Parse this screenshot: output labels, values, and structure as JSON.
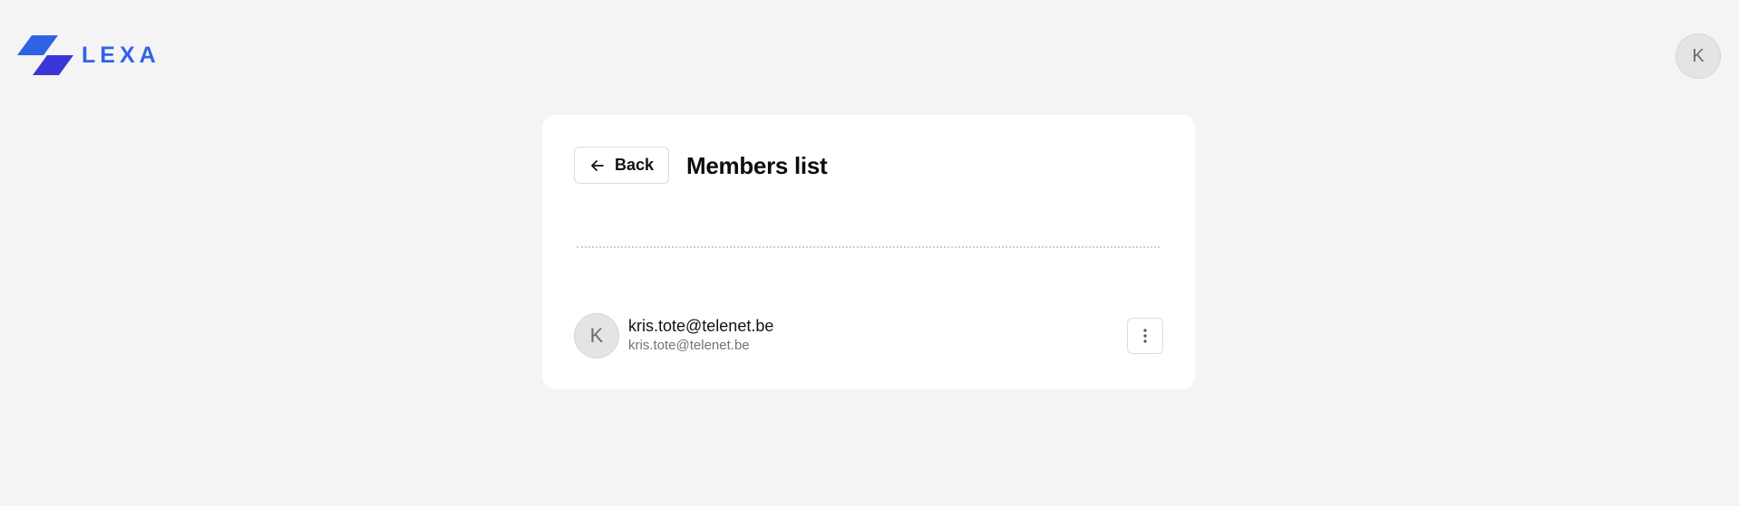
{
  "header": {
    "logo_text": "LEXA",
    "user_initial": "K"
  },
  "colors": {
    "brand": "#2f63e6",
    "brand_dark": "#3a35d6",
    "background": "#f4f4f4",
    "card": "#ffffff"
  },
  "card": {
    "back_label": "Back",
    "title": "Members list",
    "members": [
      {
        "initial": "K",
        "name": "kris.tote@telenet.be",
        "email": "kris.tote@telenet.be",
        "actions_icon": "more-vertical-icon"
      }
    ]
  },
  "icons": {
    "back": "arrow-left-icon",
    "actions": "more-vertical-icon",
    "logo": "lexa-logo-icon"
  }
}
